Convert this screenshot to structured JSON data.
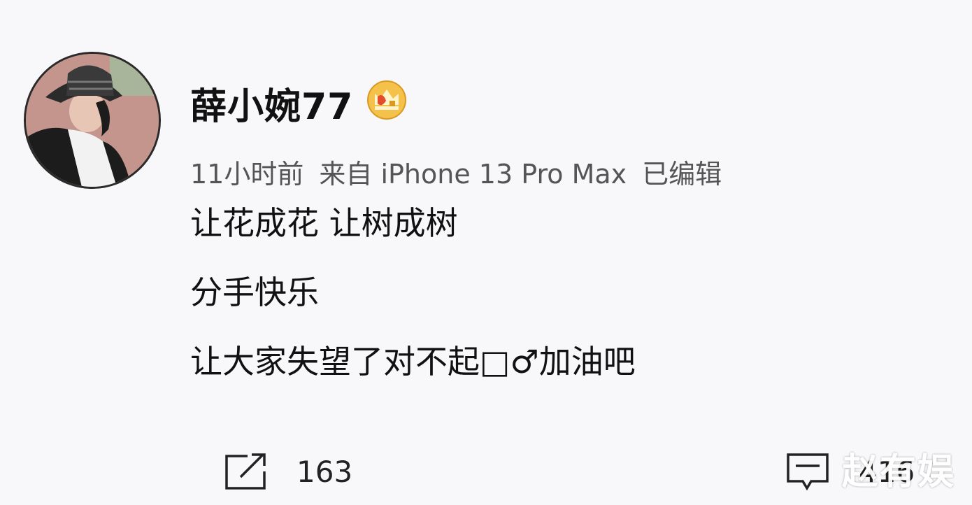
{
  "post": {
    "username": "薛小婉77",
    "meta": {
      "time": "11小时前",
      "source": "来自 iPhone 13 Pro Max",
      "edited": "已编辑"
    },
    "lines": [
      "让花成花 让树成树",
      "分手快乐",
      "让大家失望了对不起□♂加油吧"
    ],
    "actions": {
      "repost_count": "163",
      "comment_count": "416"
    }
  },
  "watermark": "赵有娱",
  "icons": {
    "vip": "crown-badge-icon",
    "repost": "share-icon",
    "comment": "comment-icon"
  },
  "colors": {
    "background": "#f8f8fb",
    "text": "#111111",
    "meta": "#555555",
    "vip_gold": "#e8a830"
  }
}
